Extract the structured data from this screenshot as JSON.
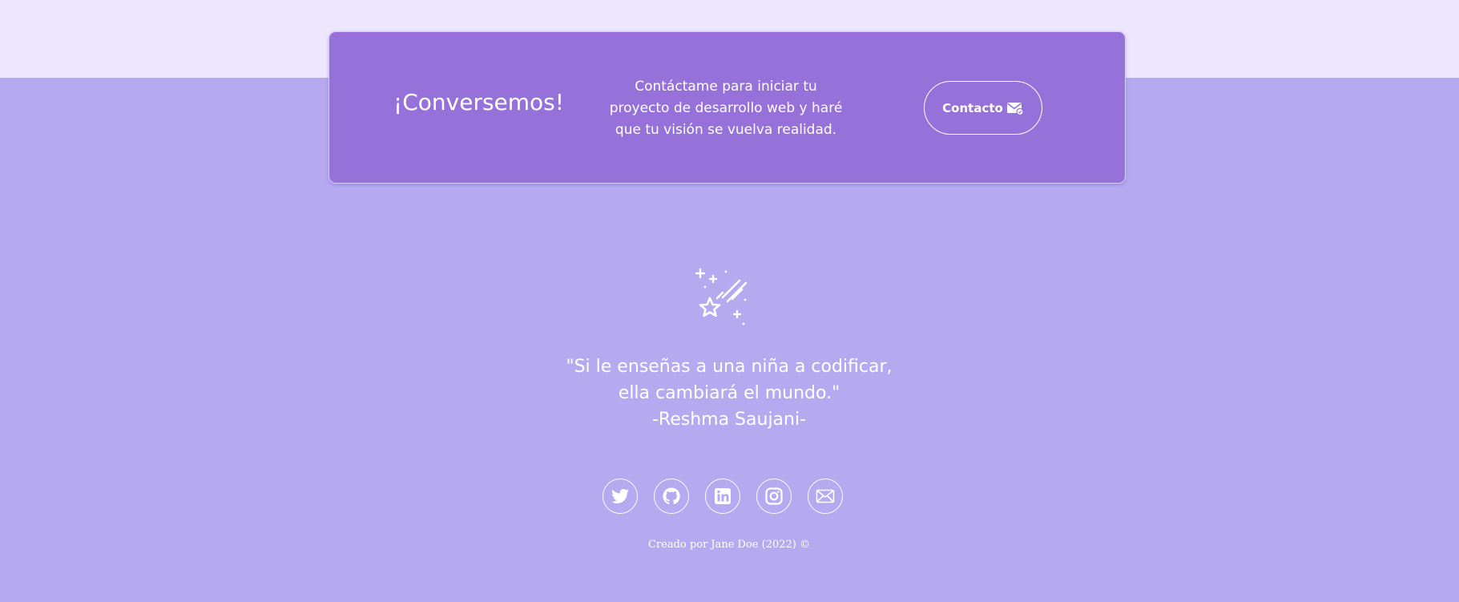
{
  "cta": {
    "title": "¡Conversemos!",
    "text": "Contáctame para iniciar tu proyecto de desarrollo web y haré que tu visión se vuelva realidad.",
    "button_label": "Contacto",
    "button_icon": "mail-icon"
  },
  "quote": {
    "line1": "\"Si le enseñas a una niña a codificar,",
    "line2": "ella cambiará el mundo.\"",
    "author": "-Reshma Saujani-"
  },
  "social": [
    {
      "icon": "twitter-icon"
    },
    {
      "icon": "github-icon"
    },
    {
      "icon": "linkedin-icon"
    },
    {
      "icon": "instagram-icon"
    },
    {
      "icon": "email-icon"
    }
  ],
  "footer": {
    "credit": "Creado por Jane Doe (2022) ©"
  },
  "colors": {
    "top_band": "#eee6ff",
    "page_background": "#b5a9f0",
    "card_background": "#9771da",
    "text": "#ffffff"
  }
}
